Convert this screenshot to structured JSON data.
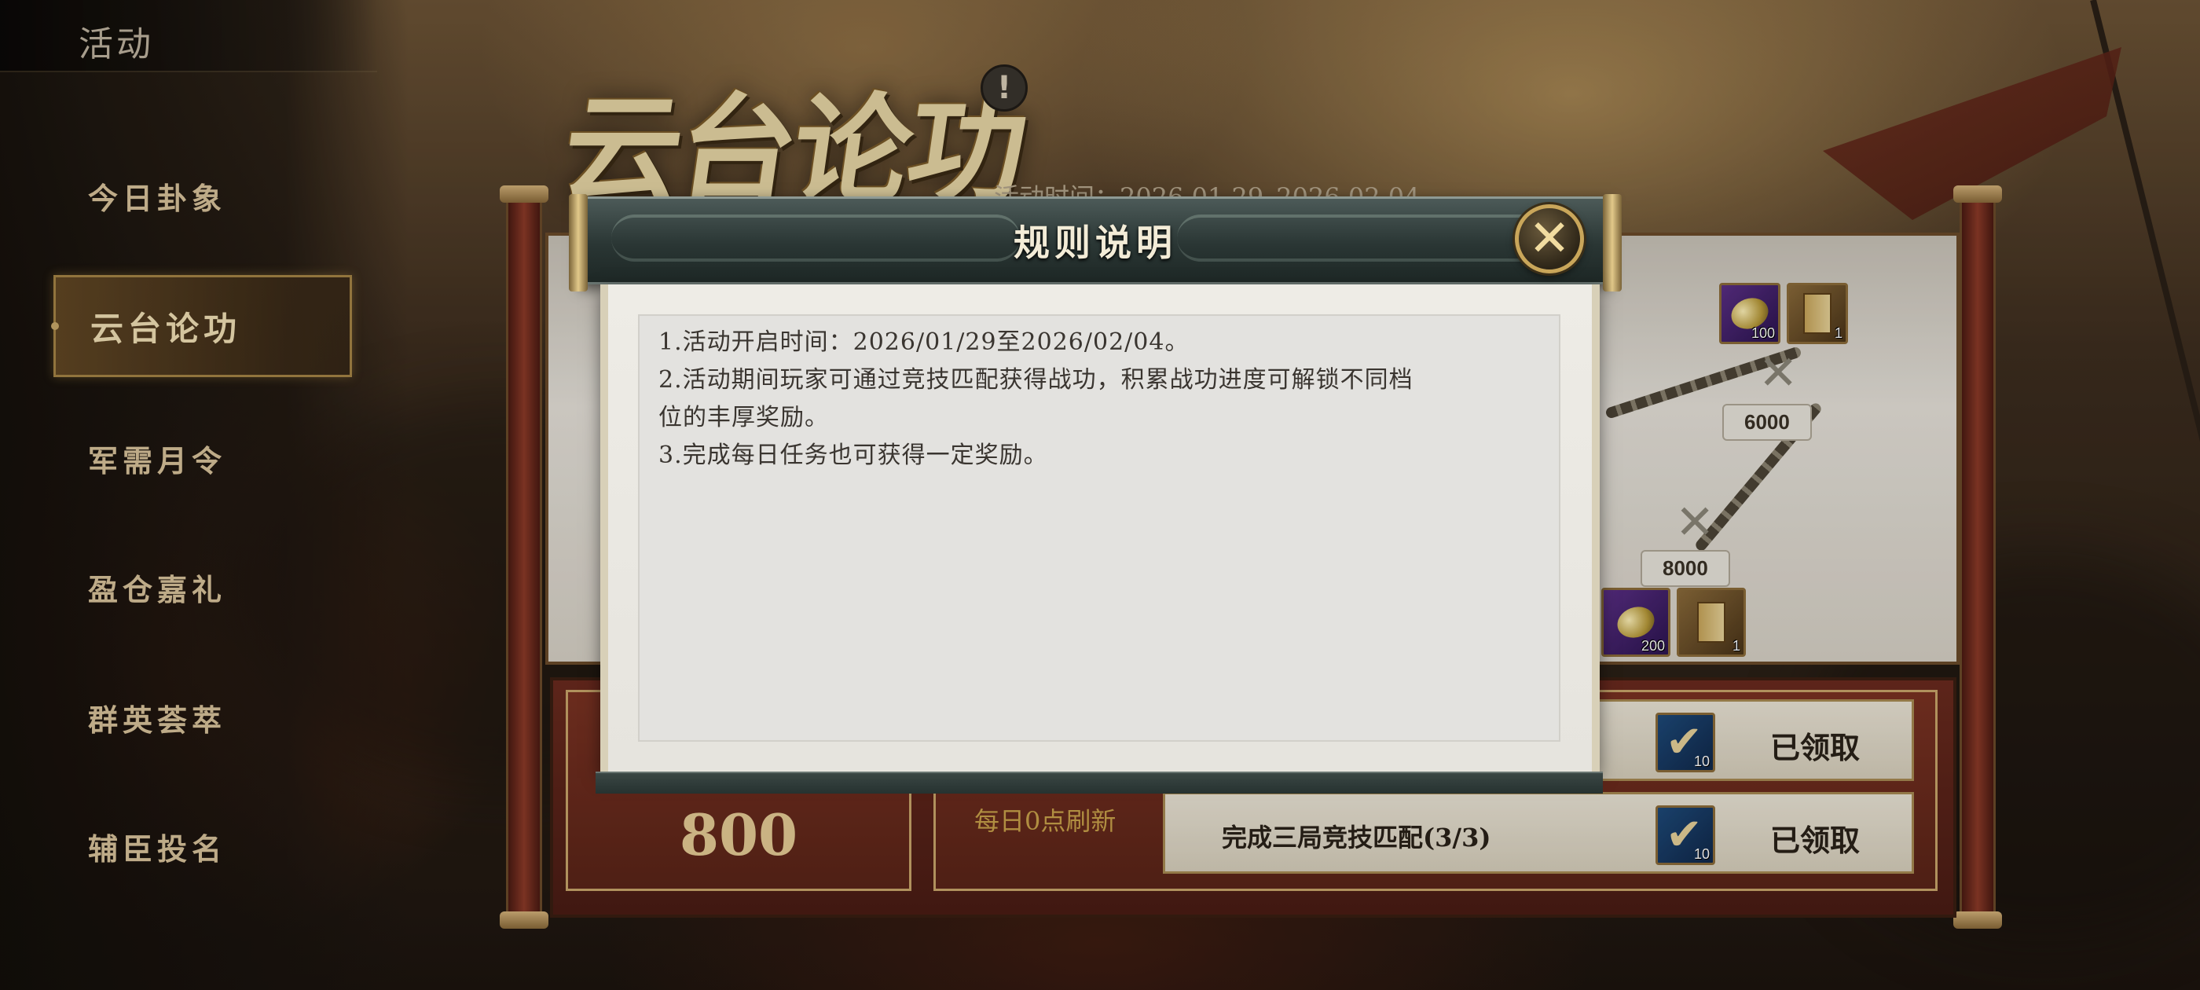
{
  "sidebar": {
    "title": "活动",
    "items": [
      {
        "label": "今日卦象"
      },
      {
        "label": "云台论功"
      },
      {
        "label": "军需月令"
      },
      {
        "label": "盈仓嘉礼"
      },
      {
        "label": "群英荟萃"
      },
      {
        "label": "辅臣投名"
      }
    ],
    "active_index": 1
  },
  "event": {
    "title": "云台论功",
    "time_text": "活动时间：2026.01.29–2026.02.04",
    "info_icon": "!"
  },
  "map": {
    "milestones": [
      "6000",
      "8000"
    ],
    "rewards_top": [
      {
        "icon": "gold-ingot-icon",
        "count": "100"
      },
      {
        "icon": "scroll-book-icon",
        "count": "1"
      }
    ],
    "rewards_bottom": [
      {
        "icon": "gold-ingot-icon",
        "count": "200"
      },
      {
        "icon": "scroll-book-icon",
        "count": "1"
      }
    ]
  },
  "progress": {
    "score": "800",
    "refresh_label": "每日0点刷新"
  },
  "tasks": [
    {
      "text": "",
      "reward_count": "10",
      "status": "已领取"
    },
    {
      "text": "完成三局竞技匹配(3/3)",
      "reward_count": "10",
      "status": "已领取"
    }
  ],
  "modal": {
    "title": "规则说明",
    "close_symbol": "✕",
    "rules": [
      "1.活动开启时间：2026/01/29至2026/02/04。",
      "2.活动期间玩家可通过竞技匹配获得战功，积累战功进度可解锁不同档",
      "位的丰厚奖励。",
      "3.完成每日任务也可获得一定奖励。"
    ]
  },
  "colors": {
    "accent_gold": "#c9a66a",
    "modal_header": "#2a3634",
    "panel_red": "#6a2a1e"
  }
}
